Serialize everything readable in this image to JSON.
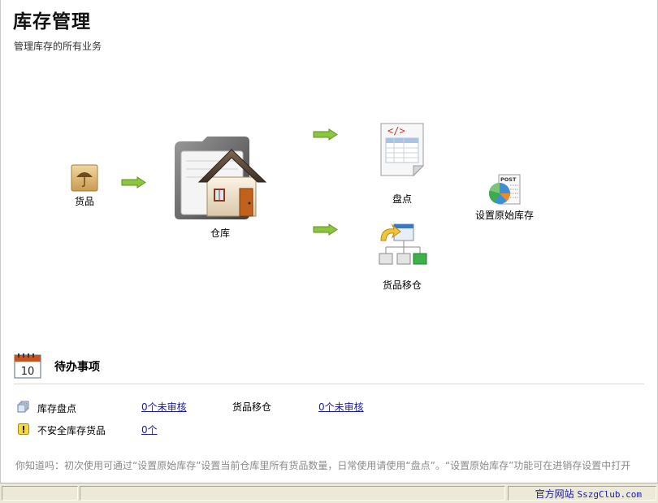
{
  "header": {
    "title": "库存管理",
    "subtitle": "管理库存的所有业务"
  },
  "flow": {
    "goods": {
      "label": "货品",
      "icon": "umbrella-box-icon"
    },
    "warehouse": {
      "label": "仓库",
      "icon": "warehouse-house-icon"
    },
    "stocktake": {
      "label": "盘点",
      "icon": "spreadsheet-doc-icon"
    },
    "transfer": {
      "label": "货品移仓",
      "icon": "transfer-tree-icon"
    },
    "initial_stock": {
      "label": "设置原始库存",
      "icon": "pie-chart-doc-icon"
    },
    "post_text": "POST",
    "calendar_text": "10"
  },
  "todo": {
    "title": "待办事项",
    "rows": [
      {
        "label": "库存盘点",
        "value": "0个未审核",
        "icon": "stacked-pages-icon"
      },
      {
        "label": "货品移仓",
        "value": "0个未审核"
      },
      {
        "label": "不安全库存货品",
        "value": "0个",
        "icon": "warning-icon"
      }
    ]
  },
  "tip": "你知道吗：初次使用可通过“设置原始库存”设置当前仓库里所有货品数量，日常使用请使用“盘点”。“设置原始库存”功能可在进销存设置中打开",
  "statusbar": {
    "link_label": "官方网站",
    "link_url_text": "SszgClub.com"
  },
  "colors": {
    "arrow_green": "#8cc63f",
    "link_blue": "#1a1aa6",
    "status_bg": "#ece9d8"
  }
}
